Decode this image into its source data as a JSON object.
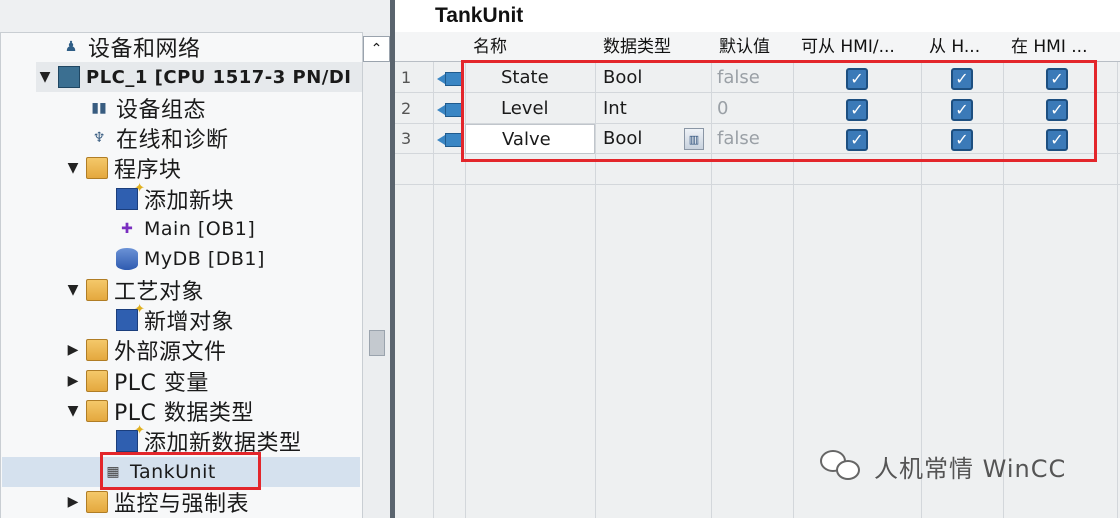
{
  "tree": {
    "items": [
      {
        "label": "设备和网络",
        "toggle": "",
        "icon": "devices-networks-icon"
      },
      {
        "label": "PLC_1 [CPU 1517-3 PN/DI",
        "toggle": "▼",
        "icon": "plc-icon"
      },
      {
        "label": "设备组态",
        "toggle": "",
        "icon": "device-config-icon"
      },
      {
        "label": "在线和诊断",
        "toggle": "",
        "icon": "online-diagnostics-icon"
      },
      {
        "label": "程序块",
        "toggle": "▼",
        "icon": "folder-icon"
      },
      {
        "label": "添加新块",
        "toggle": "",
        "icon": "add-block-icon"
      },
      {
        "label": "Main [OB1]",
        "toggle": "",
        "icon": "ob-block-icon"
      },
      {
        "label": "MyDB [DB1]",
        "toggle": "",
        "icon": "db-block-icon"
      },
      {
        "label": "工艺对象",
        "toggle": "▼",
        "icon": "folder-icon"
      },
      {
        "label": "新增对象",
        "toggle": "",
        "icon": "add-object-icon"
      },
      {
        "label": "外部源文件",
        "toggle": "▶",
        "icon": "folder-icon"
      },
      {
        "label": "PLC 变量",
        "toggle": "▶",
        "icon": "folder-icon"
      },
      {
        "label": "PLC 数据类型",
        "toggle": "▼",
        "icon": "folder-icon"
      },
      {
        "label": "添加新数据类型",
        "toggle": "",
        "icon": "add-datatype-icon"
      },
      {
        "label": "TankUnit",
        "toggle": "",
        "icon": "udt-icon"
      },
      {
        "label": "监控与强制表",
        "toggle": "▶",
        "icon": "folder-icon"
      }
    ],
    "scroll_up_glyph": "⌃"
  },
  "editor": {
    "title": "TankUnit",
    "columns": [
      "名称",
      "数据类型",
      "默认值",
      "可从 HMI/...",
      "从 H...",
      "在 HMI ..."
    ],
    "rows": [
      {
        "num": "1",
        "name": "State",
        "type": "Bool",
        "default": "false",
        "hmi_access": true,
        "hmi_visible": true,
        "hmi_setpoint": true
      },
      {
        "num": "2",
        "name": "Level",
        "type": "Int",
        "default": "0",
        "hmi_access": true,
        "hmi_visible": true,
        "hmi_setpoint": true
      },
      {
        "num": "3",
        "name": "Valve",
        "type": "Bool",
        "default": "false",
        "hmi_access": true,
        "hmi_visible": true,
        "hmi_setpoint": true
      }
    ],
    "checkbox_glyph": "✓",
    "dropdown_glyph": "▥"
  },
  "watermark": {
    "text": "人机常情 WinCC",
    "icon": "wechat-icon"
  },
  "colors": {
    "highlight": "#e3262b",
    "checkbox": "#3b7ab8",
    "selection": "#d5e1ee"
  }
}
